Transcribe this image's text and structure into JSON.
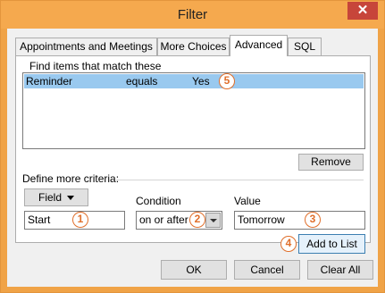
{
  "window": {
    "title": "Filter",
    "close_glyph": "✕"
  },
  "tabs": [
    {
      "label": "Appointments and Meetings"
    },
    {
      "label": "More Choices"
    },
    {
      "label": "Advanced"
    },
    {
      "label": "SQL"
    }
  ],
  "advanced": {
    "find_label": "Find items that match these",
    "criteria_row": {
      "field": "Reminder",
      "condition": "equals",
      "value": "Yes"
    },
    "remove_label": "Remove",
    "define_label": "Define more criteria:",
    "field_button_label": "Field",
    "condition_label": "Condition",
    "value_label": "Value",
    "field_value": "Start",
    "condition_selected": "on or after",
    "value_value": "Tomorrow",
    "add_to_list_label": "Add to List"
  },
  "callouts": [
    "1",
    "2",
    "3",
    "4",
    "5"
  ],
  "footer": {
    "ok_label": "OK",
    "cancel_label": "Cancel",
    "clear_all_label": "Clear All"
  },
  "colors": {
    "title_bar": "#f5a94e",
    "close_button": "#c7453a",
    "selection": "#99c9ef",
    "callout": "#e06f2b"
  }
}
